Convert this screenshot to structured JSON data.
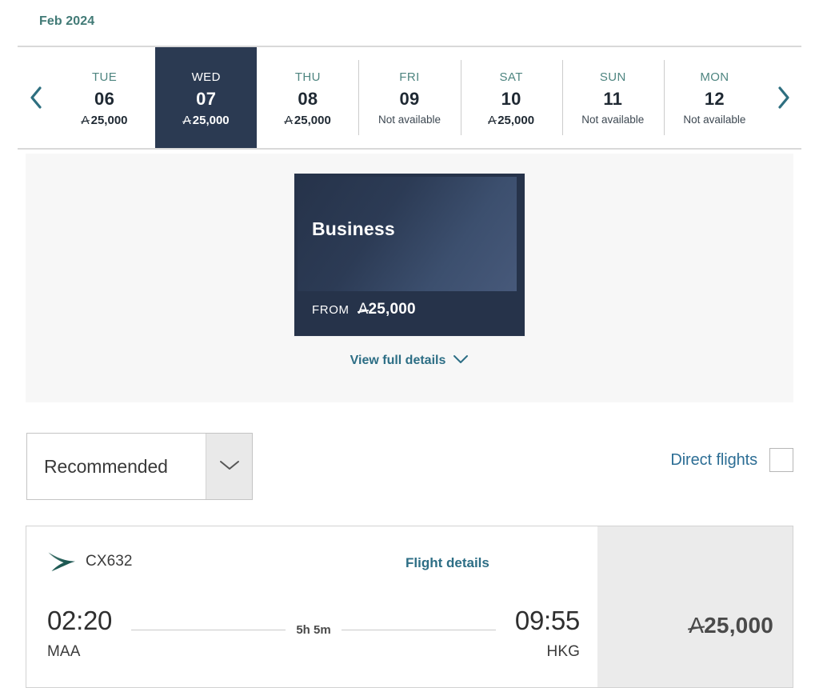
{
  "month_label": "Feb 2024",
  "currency_symbol": "A",
  "day_selector": {
    "prev_label": "Previous dates",
    "next_label": "Next dates",
    "days": [
      {
        "dow": "TUE",
        "day": "06",
        "price": "25,000",
        "available": true,
        "selected": false
      },
      {
        "dow": "WED",
        "day": "07",
        "price": "25,000",
        "available": true,
        "selected": true
      },
      {
        "dow": "THU",
        "day": "08",
        "price": "25,000",
        "available": true,
        "selected": false
      },
      {
        "dow": "FRI",
        "day": "09",
        "price": "Not available",
        "available": false,
        "selected": false
      },
      {
        "dow": "SAT",
        "day": "10",
        "price": "25,000",
        "available": true,
        "selected": false
      },
      {
        "dow": "SUN",
        "day": "11",
        "price": "Not available",
        "available": false,
        "selected": false
      },
      {
        "dow": "MON",
        "day": "12",
        "price": "Not available",
        "available": false,
        "selected": false
      }
    ]
  },
  "fare_panel": {
    "cabin": {
      "name": "Business",
      "from_label": "FROM",
      "from_price": "25,000"
    },
    "view_details_label": "View full details"
  },
  "controls": {
    "sort_value": "Recommended",
    "direct_flights_label": "Direct flights",
    "direct_flights_checked": false
  },
  "flight": {
    "flight_number": "CX632",
    "details_label": "Flight details",
    "depart_time": "02:20",
    "depart_airport": "MAA",
    "duration": "5h 5m",
    "arrive_time": "09:55",
    "arrive_airport": "HKG",
    "price": "25,000"
  },
  "colors": {
    "teal": "#417a76",
    "link_blue": "#2d6e85",
    "selected_day_bg": "#2b3a52",
    "card_dark": "#26334a",
    "panel_bg": "#f7f7f7",
    "price_block_bg": "#ebebeb",
    "brushwing_green": "#2d6660"
  }
}
